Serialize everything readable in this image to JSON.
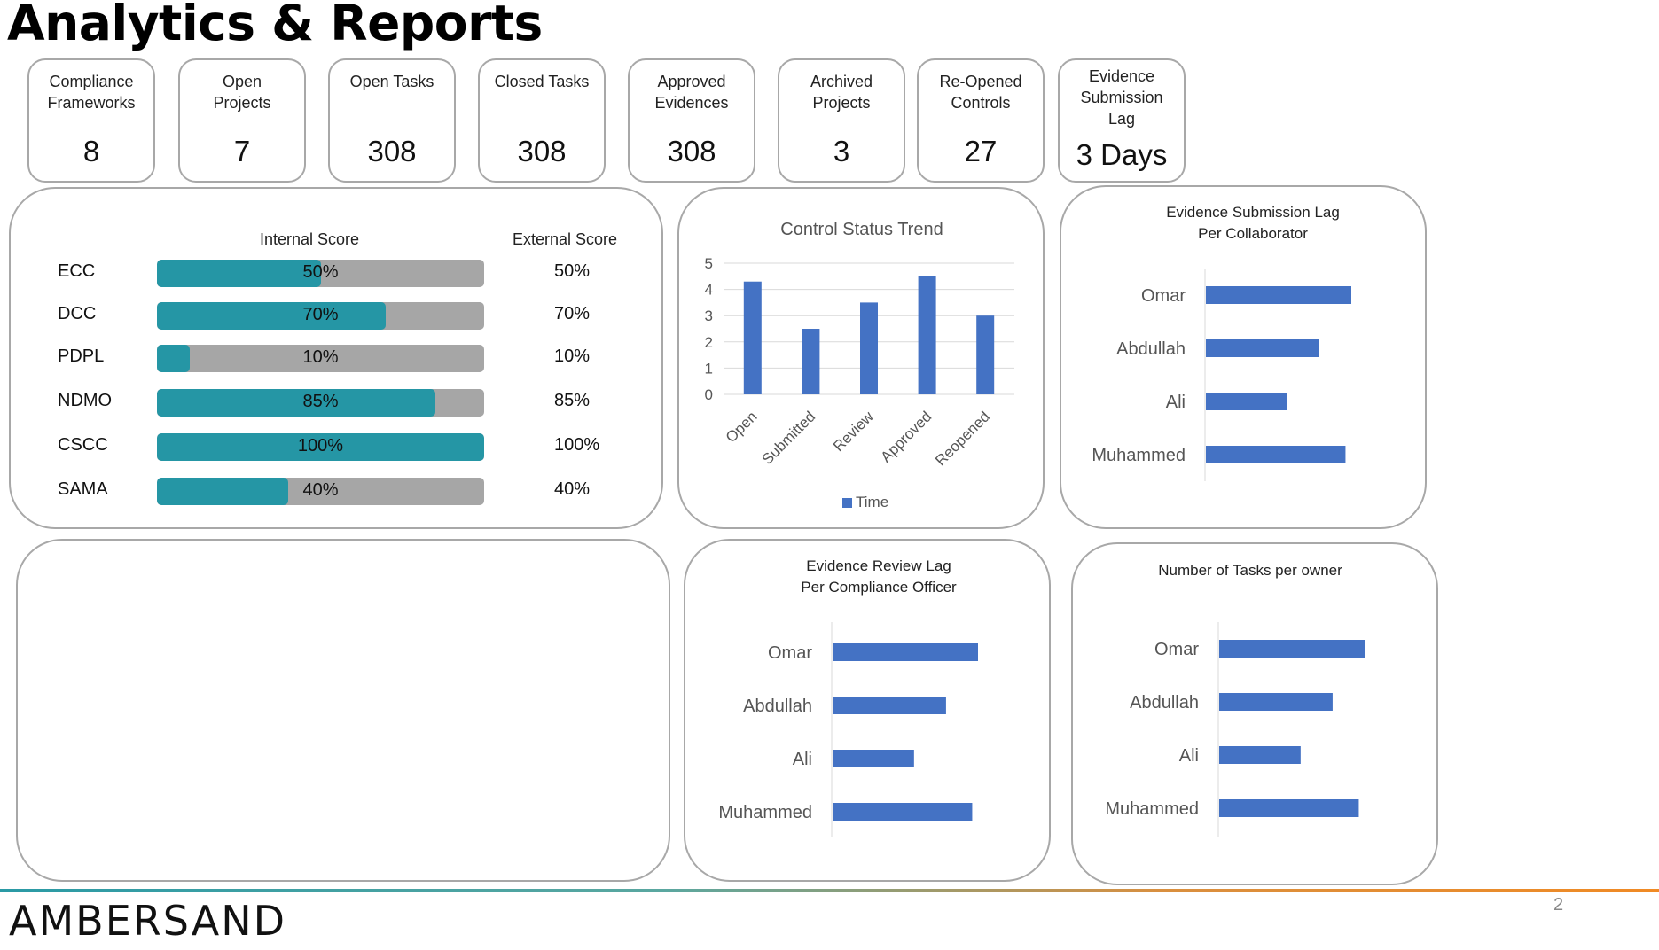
{
  "page_title": "Analytics & Reports",
  "kpis": [
    {
      "label": "Compliance Frameworks",
      "value": "8"
    },
    {
      "label": "Open Projects",
      "value": "7"
    },
    {
      "label": "Open Tasks",
      "value": "308"
    },
    {
      "label": "Closed Tasks",
      "value": "308"
    },
    {
      "label": "Approved Evidences",
      "value": "308"
    },
    {
      "label": "Archived Projects",
      "value": "3"
    },
    {
      "label": "Re-Opened Controls",
      "value": "27"
    },
    {
      "label": "Evidence Submission Lag",
      "value": "3 Days"
    }
  ],
  "scores": {
    "internal_header": "Internal Score",
    "external_header": "External Score",
    "rows": [
      {
        "name": "ECC",
        "internal": 50,
        "internal_label": "50%",
        "external": "50%"
      },
      {
        "name": "DCC",
        "internal": 70,
        "internal_label": "70%",
        "external": "70%"
      },
      {
        "name": "PDPL",
        "internal": 10,
        "internal_label": "10%",
        "external": "10%"
      },
      {
        "name": "NDMO",
        "internal": 85,
        "internal_label": "85%",
        "external": "85%"
      },
      {
        "name": "CSCC",
        "internal": 100,
        "internal_label": "100%",
        "external": "100%"
      },
      {
        "name": "SAMA",
        "internal": 40,
        "internal_label": "40%",
        "external": "40%"
      }
    ]
  },
  "colors": {
    "accent": "#2596a5",
    "track": "#a6a6a6",
    "bar": "#4472c4",
    "panel_border": "#a8a8a8"
  },
  "chart_data": [
    {
      "type": "bar",
      "title": "Control Status Trend",
      "categories": [
        "Open",
        "Submitted",
        "Review",
        "Approved",
        "Reopened"
      ],
      "series": [
        {
          "name": "Time",
          "values": [
            4.3,
            2.5,
            3.5,
            4.5,
            3.0
          ]
        }
      ],
      "ylim": [
        0,
        5
      ],
      "yticks": [
        "0",
        "1",
        "2",
        "3",
        "4",
        "5"
      ],
      "grid": true,
      "legend": "bottom"
    },
    {
      "type": "bar",
      "orientation": "horizontal",
      "title": "Evidence Submission Lag Per Collaborator",
      "categories": [
        "Omar",
        "Abdullah",
        "Ali",
        "Muhammed"
      ],
      "values": [
        5.0,
        3.9,
        2.8,
        4.8
      ]
    },
    {
      "type": "bar",
      "orientation": "horizontal",
      "title": "Evidence Review Lag Per Compliance Officer",
      "categories": [
        "Omar",
        "Abdullah",
        "Ali",
        "Muhammed"
      ],
      "values": [
        5.0,
        3.9,
        2.8,
        4.8
      ]
    },
    {
      "type": "bar",
      "orientation": "horizontal",
      "title": "Number of Tasks per owner",
      "categories": [
        "Omar",
        "Abdullah",
        "Ali",
        "Muhammed"
      ],
      "values": [
        5.0,
        3.9,
        2.8,
        4.8
      ]
    }
  ],
  "footer": {
    "logo": "AMBERSAND",
    "page_number": "2"
  }
}
